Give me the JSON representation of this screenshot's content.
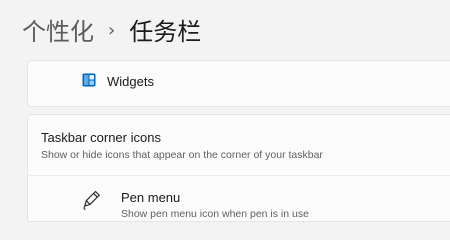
{
  "breadcrumb": {
    "parent": "个性化",
    "separator": "›",
    "current": "任务栏"
  },
  "widgets": {
    "icon": "widgets-icon",
    "label": "Widgets"
  },
  "corner_icons": {
    "title": "Taskbar corner icons",
    "description": "Show or hide icons that appear on the corner of your taskbar"
  },
  "pen_menu": {
    "icon": "pen-icon",
    "title": "Pen menu",
    "description": "Show pen menu icon when pen is in use"
  },
  "colors": {
    "background": "#f3f3f3",
    "card": "#fbfbfb",
    "accent": "#0067c0",
    "accent_light": "#5aa9e6"
  }
}
